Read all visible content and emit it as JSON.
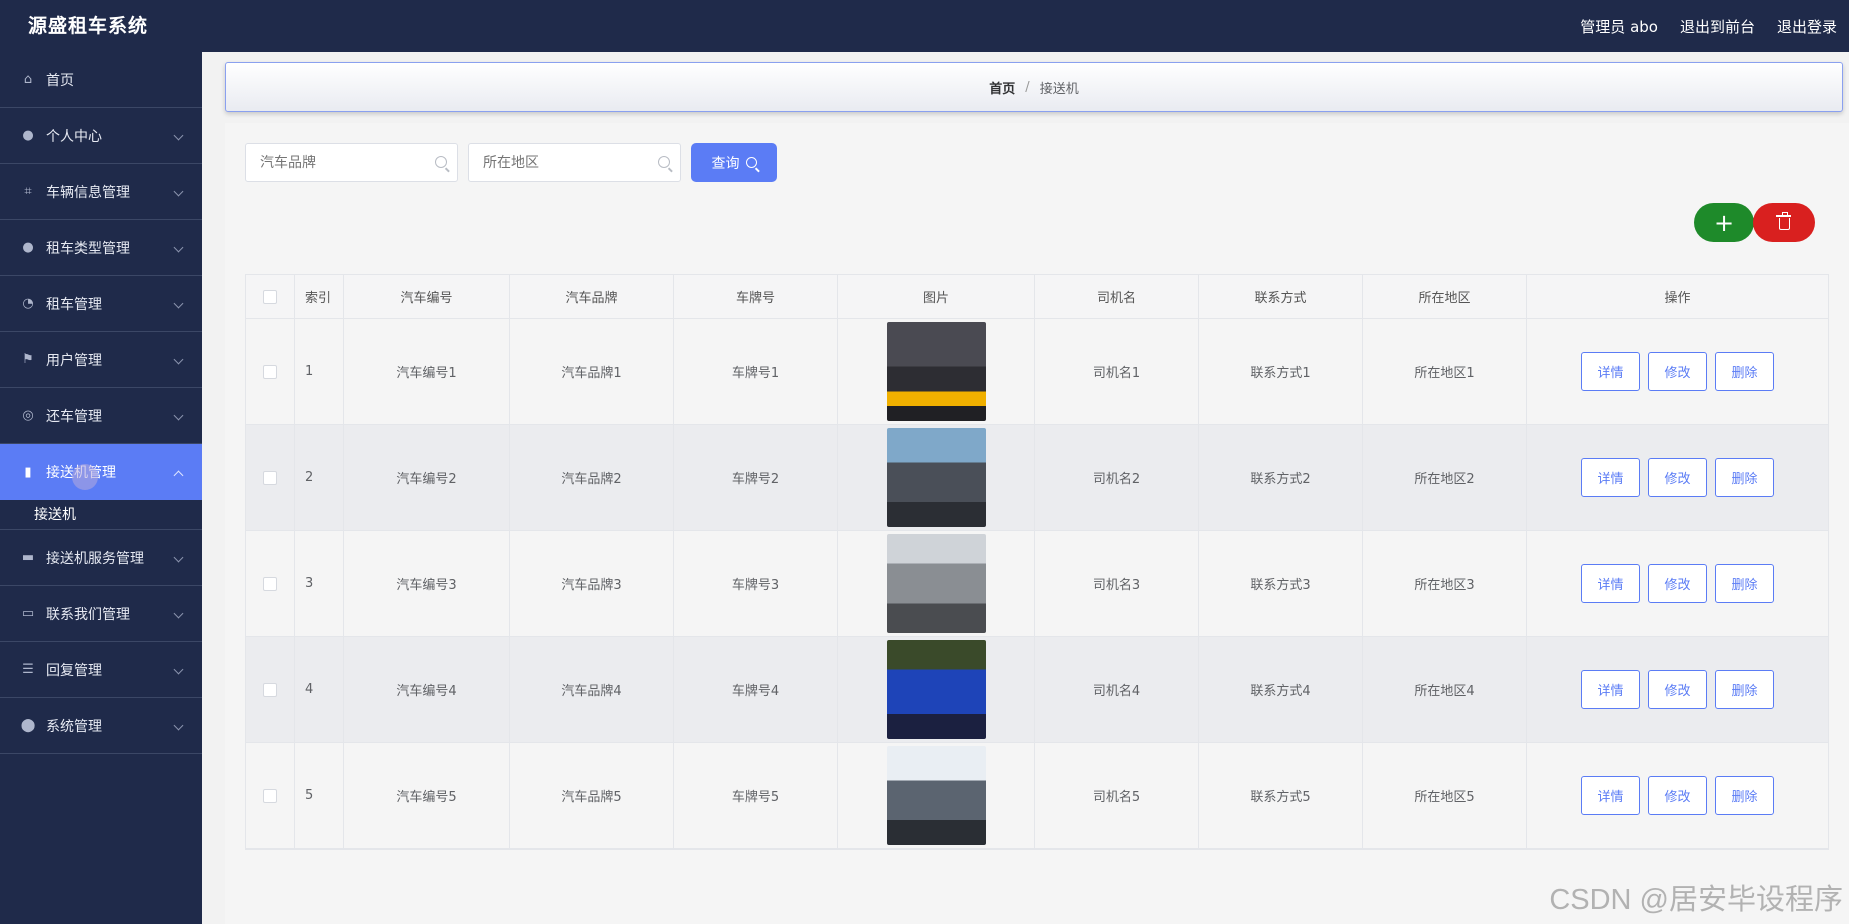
{
  "app": {
    "title": "源盛租车系统",
    "user_label": "管理员 abo",
    "exit_front": "退出到前台",
    "logout": "退出登录"
  },
  "sidebar": {
    "items": [
      {
        "label": "首页",
        "icon": "home-icon",
        "expandable": false
      },
      {
        "label": "个人中心",
        "icon": "user-icon",
        "expandable": true
      },
      {
        "label": "车辆信息管理",
        "icon": "crop-icon",
        "expandable": true
      },
      {
        "label": "租车类型管理",
        "icon": "user-icon",
        "expandable": true
      },
      {
        "label": "租车管理",
        "icon": "gauge-icon",
        "expandable": true
      },
      {
        "label": "用户管理",
        "icon": "flag-icon",
        "expandable": true
      },
      {
        "label": "还车管理",
        "icon": "lifebuoy-icon",
        "expandable": true
      },
      {
        "label": "接送机管理",
        "icon": "bar-chart-icon",
        "expandable": true,
        "active": true
      },
      {
        "label": "接送机服务管理",
        "icon": "briefcase-icon",
        "expandable": true
      },
      {
        "label": "联系我们管理",
        "icon": "chat-icon",
        "expandable": true
      },
      {
        "label": "回复管理",
        "icon": "list-icon",
        "expandable": true
      },
      {
        "label": "系统管理",
        "icon": "location-icon",
        "expandable": true
      }
    ],
    "submenu": {
      "label": "接送机"
    }
  },
  "breadcrumb": {
    "home": "首页",
    "separator": "/",
    "current": "接送机"
  },
  "search": {
    "brand_placeholder": "汽车品牌",
    "region_placeholder": "所在地区",
    "query_label": "查询"
  },
  "toolbar": {
    "add_symbol": "+"
  },
  "table": {
    "headers": {
      "index": "索引",
      "code": "汽车编号",
      "brand": "汽车品牌",
      "plate": "车牌号",
      "pic": "图片",
      "driver": "司机名",
      "contact": "联系方式",
      "region": "所在地区",
      "ops": "操作"
    },
    "rows": [
      {
        "index": "1",
        "code": "汽车编号1",
        "brand": "汽车品牌1",
        "plate": "车牌号1",
        "driver": "司机名1",
        "contact": "联系方式1",
        "region": "所在地区1"
      },
      {
        "index": "2",
        "code": "汽车编号2",
        "brand": "汽车品牌2",
        "plate": "车牌号2",
        "driver": "司机名2",
        "contact": "联系方式2",
        "region": "所在地区2"
      },
      {
        "index": "3",
        "code": "汽车编号3",
        "brand": "汽车品牌3",
        "plate": "车牌号3",
        "driver": "司机名3",
        "contact": "联系方式3",
        "region": "所在地区3"
      },
      {
        "index": "4",
        "code": "汽车编号4",
        "brand": "汽车品牌4",
        "plate": "车牌号4",
        "driver": "司机名4",
        "contact": "联系方式4",
        "region": "所在地区4"
      },
      {
        "index": "5",
        "code": "汽车编号5",
        "brand": "汽车品牌5",
        "plate": "车牌号5",
        "driver": "司机名5",
        "contact": "联系方式5",
        "region": "所在地区5"
      }
    ],
    "row_actions": {
      "detail": "详情",
      "edit": "修改",
      "delete": "删除"
    }
  },
  "watermark": "CSDN @居安毕设程序",
  "colors": {
    "topbar": "#1f2a4a",
    "accent": "#5b7cf5",
    "add": "#1e8a2a",
    "delete": "#d9201f"
  }
}
